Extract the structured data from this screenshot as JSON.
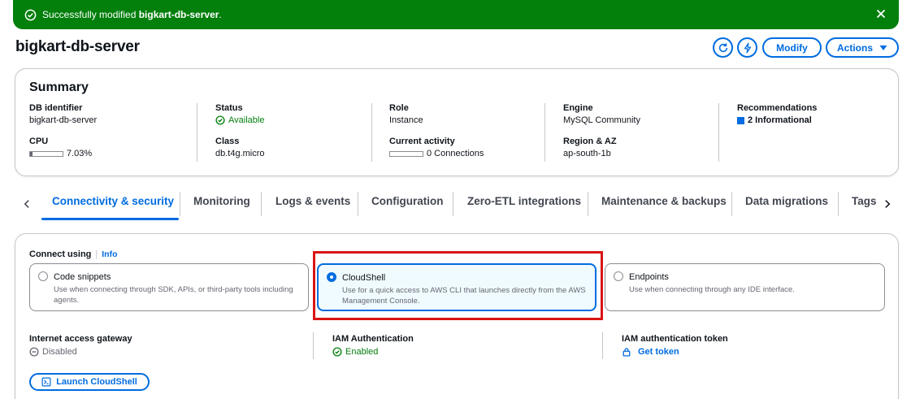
{
  "flash": {
    "prefix": "Successfully modified ",
    "resource": "bigkart-db-server",
    "suffix": "."
  },
  "header": {
    "title": "bigkart-db-server",
    "modify_label": "Modify",
    "actions_label": "Actions"
  },
  "summary": {
    "heading": "Summary",
    "db_identifier_label": "DB identifier",
    "db_identifier": "bigkart-db-server",
    "cpu_label": "CPU",
    "cpu_value": "7.03%",
    "cpu_fraction": 0.0703,
    "status_label": "Status",
    "status_value": "Available",
    "class_label": "Class",
    "class_value": "db.t4g.micro",
    "role_label": "Role",
    "role_value": "Instance",
    "activity_label": "Current activity",
    "activity_value": "0 Connections",
    "engine_label": "Engine",
    "engine_value": "MySQL Community",
    "region_label": "Region & AZ",
    "region_value": "ap-south-1b",
    "recommendations_label": "Recommendations",
    "recommendations_value": "2 Informational"
  },
  "tabs": [
    {
      "label": "Connectivity & security",
      "active": true
    },
    {
      "label": "Monitoring"
    },
    {
      "label": "Logs & events"
    },
    {
      "label": "Configuration"
    },
    {
      "label": "Zero-ETL integrations"
    },
    {
      "label": "Maintenance & backups"
    },
    {
      "label": "Data migrations"
    },
    {
      "label": "Tags"
    }
  ],
  "connect": {
    "label": "Connect using",
    "info": "Info",
    "options": [
      {
        "title": "Code snippets",
        "desc": "Use when connecting through SDK, APIs, or third-party tools including agents.",
        "selected": false
      },
      {
        "title": "CloudShell",
        "desc": "Use for a quick access to AWS CLI that launches directly from the AWS Management Console.",
        "selected": true
      },
      {
        "title": "Endpoints",
        "desc": "Use when connecting through any IDE interface.",
        "selected": false
      }
    ],
    "gateway_label": "Internet access gateway",
    "gateway_value": "Disabled",
    "iam_label": "IAM Authentication",
    "iam_value": "Enabled",
    "token_label": "IAM authentication token",
    "token_value": "Get token",
    "launch_label": "Launch CloudShell"
  },
  "colors": {
    "success": "#037f0c",
    "link": "#006ce0",
    "highlight": "#d91515"
  }
}
